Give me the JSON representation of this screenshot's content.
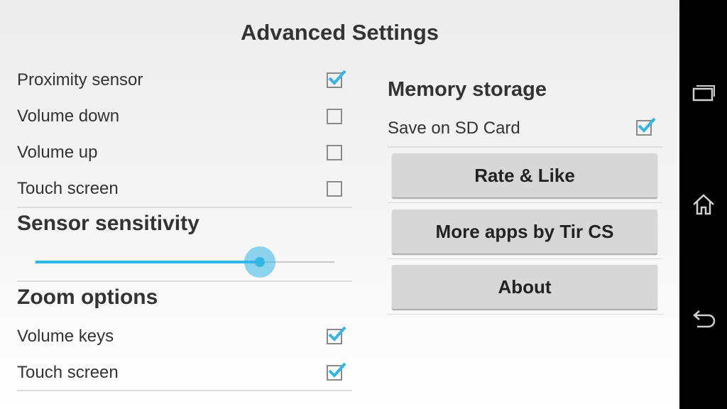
{
  "title": "Advanced Settings",
  "left": {
    "triggers": [
      {
        "label": "Proximity sensor",
        "checked": true
      },
      {
        "label": "Volume down",
        "checked": false
      },
      {
        "label": "Volume up",
        "checked": false
      },
      {
        "label": "Touch screen",
        "checked": false
      }
    ],
    "sensitivity": {
      "heading": "Sensor sensitivity",
      "value_fraction": 0.75
    },
    "zoom": {
      "heading": "Zoom options",
      "items": [
        {
          "label": "Volume keys",
          "checked": true
        },
        {
          "label": "Touch screen",
          "checked": true
        }
      ]
    }
  },
  "right": {
    "memory_heading": "Memory storage",
    "save_sd": {
      "label": "Save on SD Card",
      "checked": true
    },
    "buttons": [
      "Rate & Like",
      "More apps by Tir CS",
      "About"
    ]
  },
  "navbar": {
    "icons": [
      "recent-apps-icon",
      "home-icon",
      "back-icon"
    ]
  },
  "colors": {
    "accent": "#33b5e5",
    "navbar": "#000000",
    "button_bg": "#d7d7d7"
  }
}
